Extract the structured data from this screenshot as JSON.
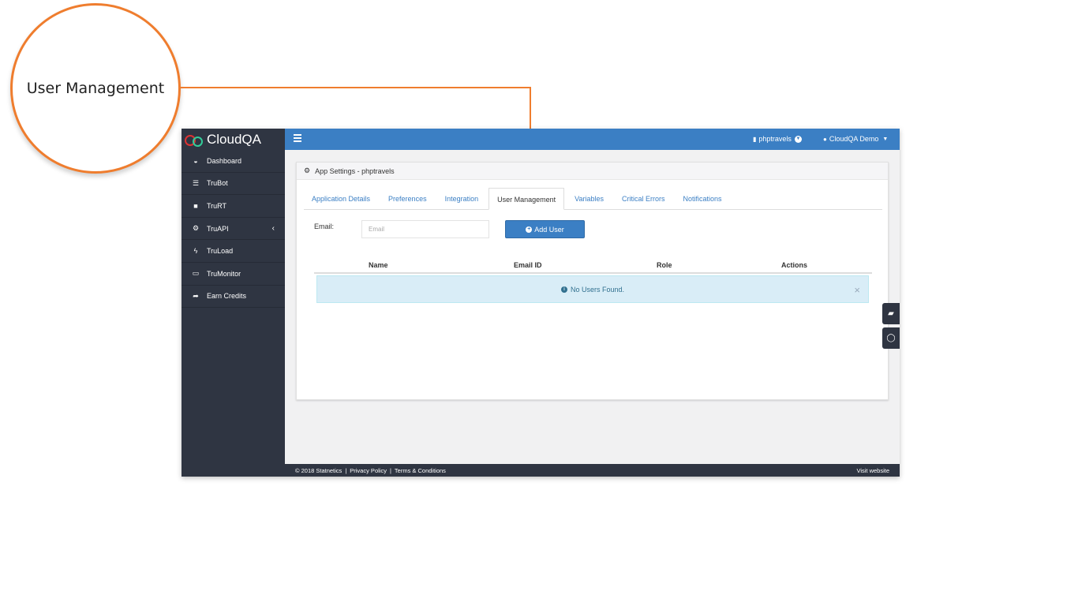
{
  "callout": {
    "label": "User Management"
  },
  "sidebar": {
    "logo_text": "CloudQA",
    "items": [
      {
        "label": "Dashboard",
        "icon": "dashboard-icon"
      },
      {
        "label": "TruBot",
        "icon": "list-icon"
      },
      {
        "label": "TruRT",
        "icon": "briefcase-icon"
      },
      {
        "label": "TruAPI",
        "icon": "cogs-icon"
      },
      {
        "label": "TruLoad",
        "icon": "bolt-icon"
      },
      {
        "label": "TruMonitor",
        "icon": "monitor-icon"
      },
      {
        "label": "Earn Credits",
        "icon": "share-icon"
      }
    ]
  },
  "topbar": {
    "project": "phptravels",
    "user": "CloudQA Demo"
  },
  "panel": {
    "title": "App Settings - phptravels",
    "tabs": [
      "Application Details",
      "Preferences",
      "Integration",
      "User Management",
      "Variables",
      "Critical Errors",
      "Notifications"
    ],
    "active_tab": "User Management",
    "email_label": "Email:",
    "email_placeholder": "Email",
    "add_button": "Add User",
    "columns": [
      "Name",
      "Email ID",
      "Role",
      "Actions"
    ],
    "alert": "No Users Found."
  },
  "footer": {
    "copyright": "© 2018 Statnetics",
    "privacy": "Privacy Policy",
    "terms": "Terms & Conditions",
    "visit": "Visit website"
  },
  "colors": {
    "accent": "#ef7d2e",
    "primary": "#3b7fc4",
    "sidebar": "#2f3542",
    "alert_bg": "#d9edf7"
  }
}
